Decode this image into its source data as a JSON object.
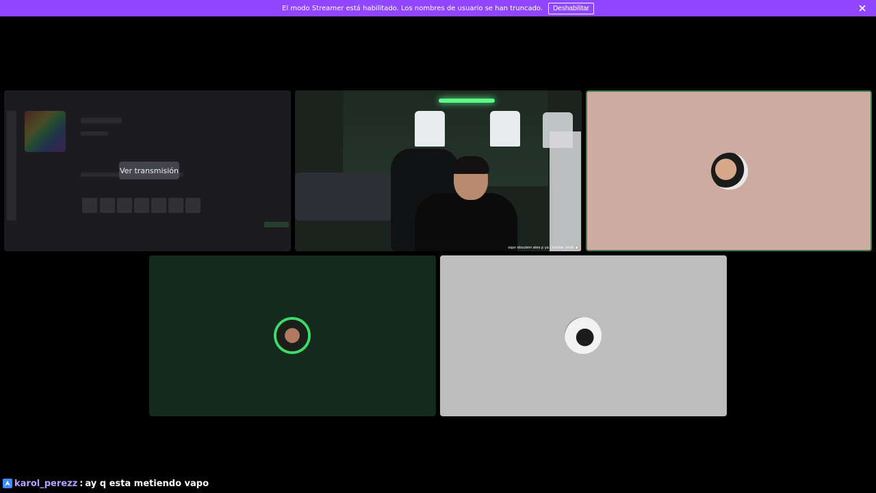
{
  "banner": {
    "message": "El modo Streamer está habilitado. Los nombres de usuario se han truncado.",
    "disable_label": "Deshabilitar",
    "close_icon": "close-icon",
    "color": "#9147ff"
  },
  "tiles": {
    "screen_share": {
      "watch_label": "Ver transmisión"
    },
    "camera": {
      "overlay_caption": "oqor oboulem ates p ya | izomer_kneil 📋"
    }
  },
  "chat": {
    "badge_icon": "prime-badge-icon",
    "username": "karol_perezz",
    "separator": ":",
    "message": "ay q esta metiendo vapo"
  }
}
